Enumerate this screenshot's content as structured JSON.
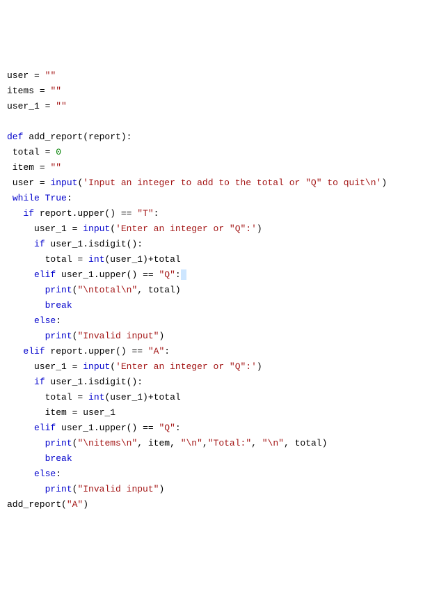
{
  "code": {
    "tokens": [
      [
        {
          "t": "user ",
          "c": "name"
        },
        {
          "t": "=",
          "c": "op"
        },
        {
          "t": " ",
          "c": "name"
        },
        {
          "t": "\"\"",
          "c": "str"
        }
      ],
      [
        {
          "t": "items ",
          "c": "name"
        },
        {
          "t": "=",
          "c": "op"
        },
        {
          "t": " ",
          "c": "name"
        },
        {
          "t": "\"\"",
          "c": "str"
        }
      ],
      [
        {
          "t": "user_1 ",
          "c": "name"
        },
        {
          "t": "=",
          "c": "op"
        },
        {
          "t": " ",
          "c": "name"
        },
        {
          "t": "\"\"",
          "c": "str"
        }
      ],
      [],
      [
        {
          "t": "def",
          "c": "k"
        },
        {
          "t": " add_report(report):",
          "c": "name"
        }
      ],
      [
        {
          "t": " total ",
          "c": "name"
        },
        {
          "t": "=",
          "c": "op"
        },
        {
          "t": " ",
          "c": "name"
        },
        {
          "t": "0",
          "c": "num"
        }
      ],
      [
        {
          "t": " item ",
          "c": "name"
        },
        {
          "t": "=",
          "c": "op"
        },
        {
          "t": " ",
          "c": "name"
        },
        {
          "t": "\"\"",
          "c": "str"
        }
      ],
      [
        {
          "t": " user ",
          "c": "name"
        },
        {
          "t": "=",
          "c": "op"
        },
        {
          "t": " ",
          "c": "name"
        },
        {
          "t": "input",
          "c": "builtin"
        },
        {
          "t": "(",
          "c": "name"
        },
        {
          "t": "'Input an integer to add to the total or \"Q\" to quit\\n'",
          "c": "str"
        },
        {
          "t": ")",
          "c": "name"
        }
      ],
      [
        {
          "t": " ",
          "c": "name"
        },
        {
          "t": "while",
          "c": "k"
        },
        {
          "t": " ",
          "c": "name"
        },
        {
          "t": "True",
          "c": "k"
        },
        {
          "t": ":",
          "c": "name"
        }
      ],
      [
        {
          "t": "   ",
          "c": "name"
        },
        {
          "t": "if",
          "c": "k"
        },
        {
          "t": " report.upper() ",
          "c": "name"
        },
        {
          "t": "==",
          "c": "op"
        },
        {
          "t": " ",
          "c": "name"
        },
        {
          "t": "\"T\"",
          "c": "str"
        },
        {
          "t": ":",
          "c": "name"
        }
      ],
      [
        {
          "t": "     user_1 ",
          "c": "name"
        },
        {
          "t": "=",
          "c": "op"
        },
        {
          "t": " ",
          "c": "name"
        },
        {
          "t": "input",
          "c": "builtin"
        },
        {
          "t": "(",
          "c": "name"
        },
        {
          "t": "'Enter an integer or \"Q\":'",
          "c": "str"
        },
        {
          "t": ")",
          "c": "name"
        }
      ],
      [
        {
          "t": "     ",
          "c": "name"
        },
        {
          "t": "if",
          "c": "k"
        },
        {
          "t": " user_1.isdigit():",
          "c": "name"
        }
      ],
      [
        {
          "t": "       total ",
          "c": "name"
        },
        {
          "t": "=",
          "c": "op"
        },
        {
          "t": " ",
          "c": "name"
        },
        {
          "t": "int",
          "c": "builtin"
        },
        {
          "t": "(user_1)",
          "c": "name"
        },
        {
          "t": "+",
          "c": "op"
        },
        {
          "t": "total",
          "c": "name"
        }
      ],
      [
        {
          "t": "     ",
          "c": "name"
        },
        {
          "t": "elif",
          "c": "k"
        },
        {
          "t": " user_1.upper() ",
          "c": "name"
        },
        {
          "t": "==",
          "c": "op"
        },
        {
          "t": " ",
          "c": "name"
        },
        {
          "t": "\"Q\"",
          "c": "str"
        },
        {
          "t": ":",
          "c": "name"
        },
        {
          "t": " ",
          "c": "hl"
        }
      ],
      [
        {
          "t": "       ",
          "c": "name"
        },
        {
          "t": "print",
          "c": "builtin"
        },
        {
          "t": "(",
          "c": "name"
        },
        {
          "t": "\"\\ntotal\\n\"",
          "c": "str"
        },
        {
          "t": ", total)",
          "c": "name"
        }
      ],
      [
        {
          "t": "       ",
          "c": "name"
        },
        {
          "t": "break",
          "c": "k"
        }
      ],
      [
        {
          "t": "     ",
          "c": "name"
        },
        {
          "t": "else",
          "c": "k"
        },
        {
          "t": ":",
          "c": "name"
        }
      ],
      [
        {
          "t": "       ",
          "c": "name"
        },
        {
          "t": "print",
          "c": "builtin"
        },
        {
          "t": "(",
          "c": "name"
        },
        {
          "t": "\"Invalid input\"",
          "c": "str"
        },
        {
          "t": ")",
          "c": "name"
        }
      ],
      [
        {
          "t": "   ",
          "c": "name"
        },
        {
          "t": "elif",
          "c": "k"
        },
        {
          "t": " report.upper() ",
          "c": "name"
        },
        {
          "t": "==",
          "c": "op"
        },
        {
          "t": " ",
          "c": "name"
        },
        {
          "t": "\"A\"",
          "c": "str"
        },
        {
          "t": ":",
          "c": "name"
        }
      ],
      [
        {
          "t": "     user_1 ",
          "c": "name"
        },
        {
          "t": "=",
          "c": "op"
        },
        {
          "t": " ",
          "c": "name"
        },
        {
          "t": "input",
          "c": "builtin"
        },
        {
          "t": "(",
          "c": "name"
        },
        {
          "t": "'Enter an integer or \"Q\":'",
          "c": "str"
        },
        {
          "t": ")",
          "c": "name"
        }
      ],
      [
        {
          "t": "     ",
          "c": "name"
        },
        {
          "t": "if",
          "c": "k"
        },
        {
          "t": " user_1.isdigit():",
          "c": "name"
        }
      ],
      [
        {
          "t": "       total ",
          "c": "name"
        },
        {
          "t": "=",
          "c": "op"
        },
        {
          "t": " ",
          "c": "name"
        },
        {
          "t": "int",
          "c": "builtin"
        },
        {
          "t": "(user_1)",
          "c": "name"
        },
        {
          "t": "+",
          "c": "op"
        },
        {
          "t": "total",
          "c": "name"
        }
      ],
      [
        {
          "t": "       item ",
          "c": "name"
        },
        {
          "t": "=",
          "c": "op"
        },
        {
          "t": " user_1",
          "c": "name"
        }
      ],
      [
        {
          "t": "     ",
          "c": "name"
        },
        {
          "t": "elif",
          "c": "k"
        },
        {
          "t": " user_1.upper() ",
          "c": "name"
        },
        {
          "t": "==",
          "c": "op"
        },
        {
          "t": " ",
          "c": "name"
        },
        {
          "t": "\"Q\"",
          "c": "str"
        },
        {
          "t": ":",
          "c": "name"
        }
      ],
      [
        {
          "t": "       ",
          "c": "name"
        },
        {
          "t": "print",
          "c": "builtin"
        },
        {
          "t": "(",
          "c": "name"
        },
        {
          "t": "\"\\nitems\\n\"",
          "c": "str"
        },
        {
          "t": ", item, ",
          "c": "name"
        },
        {
          "t": "\"\\n\"",
          "c": "str"
        },
        {
          "t": ",",
          "c": "name"
        },
        {
          "t": "\"Total:\"",
          "c": "str"
        },
        {
          "t": ", ",
          "c": "name"
        },
        {
          "t": "\"\\n\"",
          "c": "str"
        },
        {
          "t": ", total)",
          "c": "name"
        }
      ],
      [
        {
          "t": "       ",
          "c": "name"
        },
        {
          "t": "break",
          "c": "k"
        }
      ],
      [
        {
          "t": "     ",
          "c": "name"
        },
        {
          "t": "else",
          "c": "k"
        },
        {
          "t": ":",
          "c": "name"
        }
      ],
      [
        {
          "t": "       ",
          "c": "name"
        },
        {
          "t": "print",
          "c": "builtin"
        },
        {
          "t": "(",
          "c": "name"
        },
        {
          "t": "\"Invalid input\"",
          "c": "str"
        },
        {
          "t": ")",
          "c": "name"
        }
      ],
      [
        {
          "t": "add_report(",
          "c": "name"
        },
        {
          "t": "\"A\"",
          "c": "str"
        },
        {
          "t": ")",
          "c": "name"
        }
      ]
    ]
  }
}
